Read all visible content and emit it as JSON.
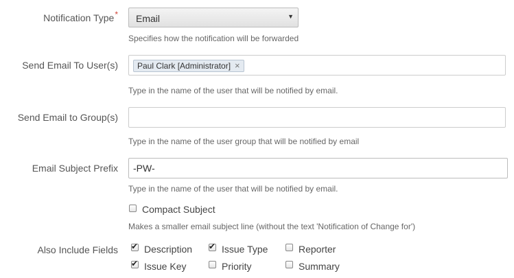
{
  "notification_type": {
    "label": "Notification Type",
    "required_mark": "*",
    "value": "Email",
    "help": "Specifies how the notification will be forwarded"
  },
  "send_to_users": {
    "label": "Send Email To User(s)",
    "chips": [
      {
        "label": "Paul Clark [Administrator]",
        "remove": "×"
      }
    ],
    "help": "Type in the name of the user that will be notified by email."
  },
  "send_to_groups": {
    "label": "Send Email to Group(s)",
    "value": "",
    "help": "Type in the name of the user group that will be notified by email"
  },
  "subject_prefix": {
    "label": "Email Subject Prefix",
    "value": "-PW-",
    "help": "Type in the name of the user that will be notified by email."
  },
  "compact_subject": {
    "label": "Compact Subject",
    "checked": false,
    "help": "Makes a smaller email subject line (without the text 'Notification of Change for')"
  },
  "include_fields": {
    "label": "Also Include Fields",
    "options": [
      {
        "label": "Description",
        "checked": true
      },
      {
        "label": "Issue Type",
        "checked": true
      },
      {
        "label": "Reporter",
        "checked": false
      },
      {
        "label": "Issue Key",
        "checked": true
      },
      {
        "label": "Priority",
        "checked": false
      },
      {
        "label": "Summary",
        "checked": false
      }
    ]
  },
  "icons": {
    "check": "✔",
    "caret": "▼"
  }
}
